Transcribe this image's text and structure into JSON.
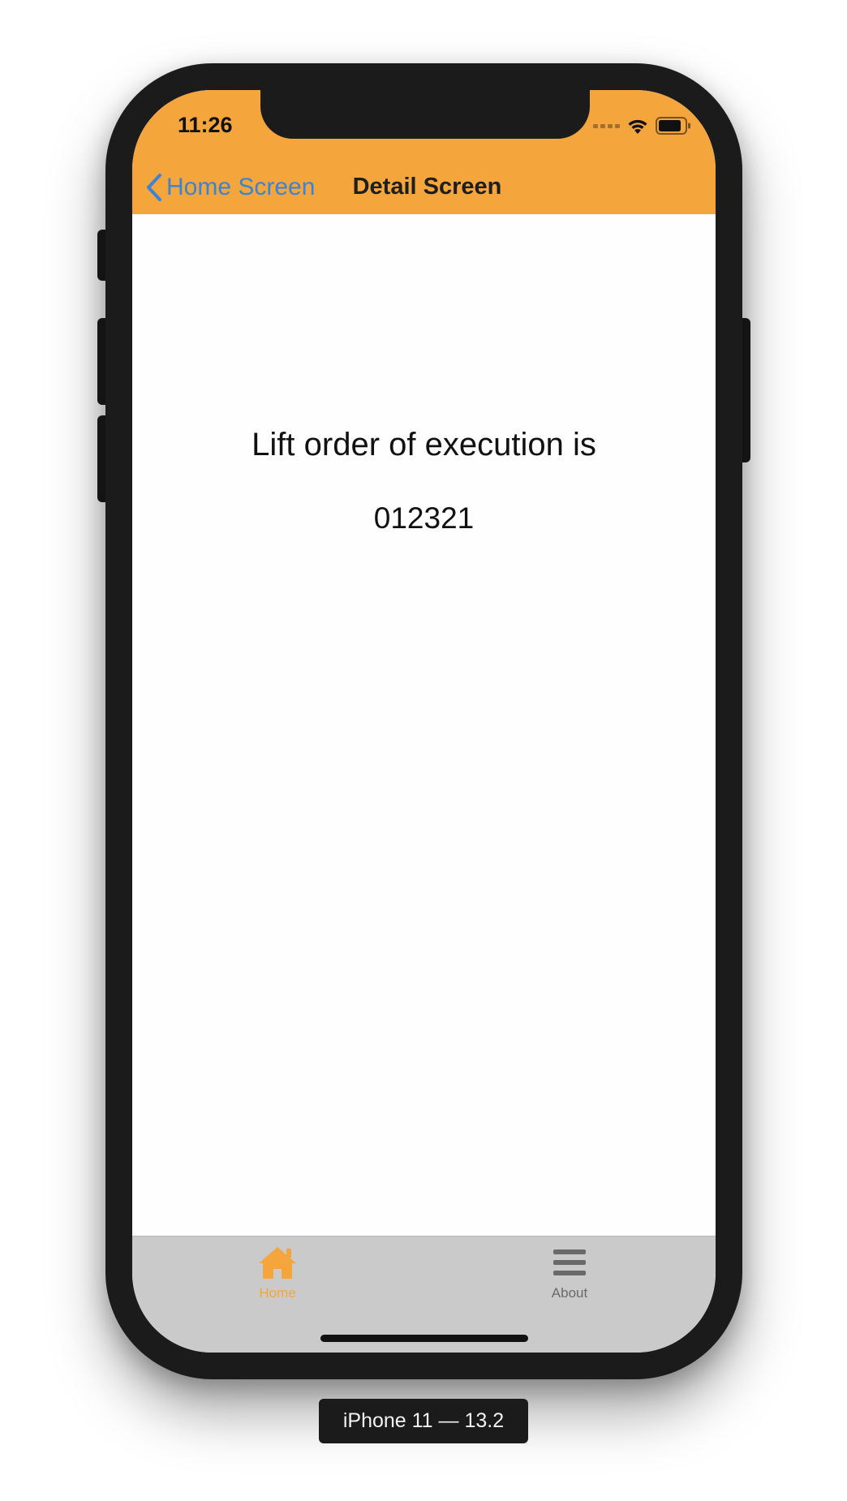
{
  "status_bar": {
    "time": "11:26",
    "icons": [
      "cellular-signal-icon",
      "wifi-icon",
      "battery-icon"
    ]
  },
  "nav": {
    "back_label": "Home Screen",
    "title": "Detail Screen"
  },
  "content": {
    "line1": "Lift order of execution is",
    "line2": "012321"
  },
  "tabbar": {
    "tabs": [
      {
        "label": "Home",
        "icon": "home-icon",
        "active": true
      },
      {
        "label": "About",
        "icon": "menu-icon",
        "active": false
      }
    ]
  },
  "device_caption": "iPhone 11 — 13.2",
  "colors": {
    "accent": "#f4a53b",
    "link": "#3b83d6",
    "tabbar_bg": "#cacaca",
    "frame": "#1b1b1c"
  }
}
